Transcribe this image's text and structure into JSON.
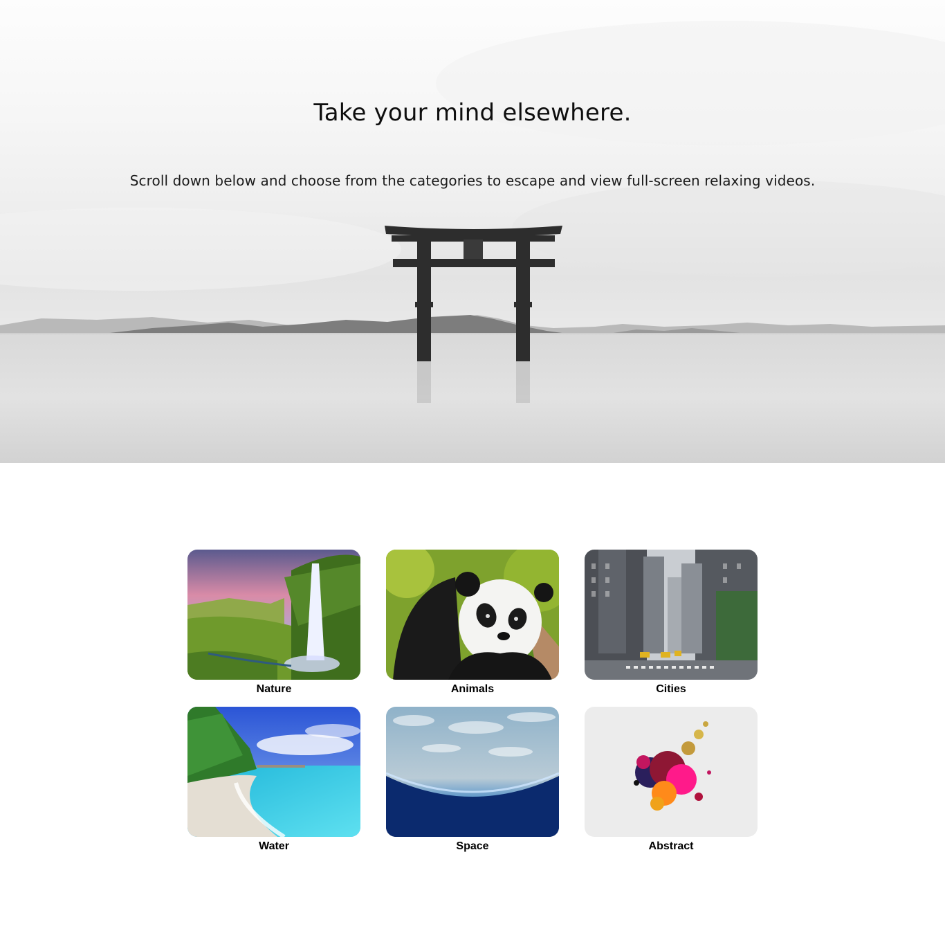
{
  "hero": {
    "title": "Take your mind elsewhere.",
    "subtitle": "Scroll down below and choose from the categories to escape and view full-screen relaxing videos.",
    "image": "torii-gate-lake-photo"
  },
  "categories": [
    {
      "label": "Nature",
      "image": "waterfall-photo"
    },
    {
      "label": "Animals",
      "image": "panda-photo"
    },
    {
      "label": "Cities",
      "image": "city-street-photo"
    },
    {
      "label": "Water",
      "image": "tropical-beach-photo"
    },
    {
      "label": "Space",
      "image": "earth-from-orbit-photo"
    },
    {
      "label": "Abstract",
      "image": "ink-splash-photo"
    }
  ]
}
